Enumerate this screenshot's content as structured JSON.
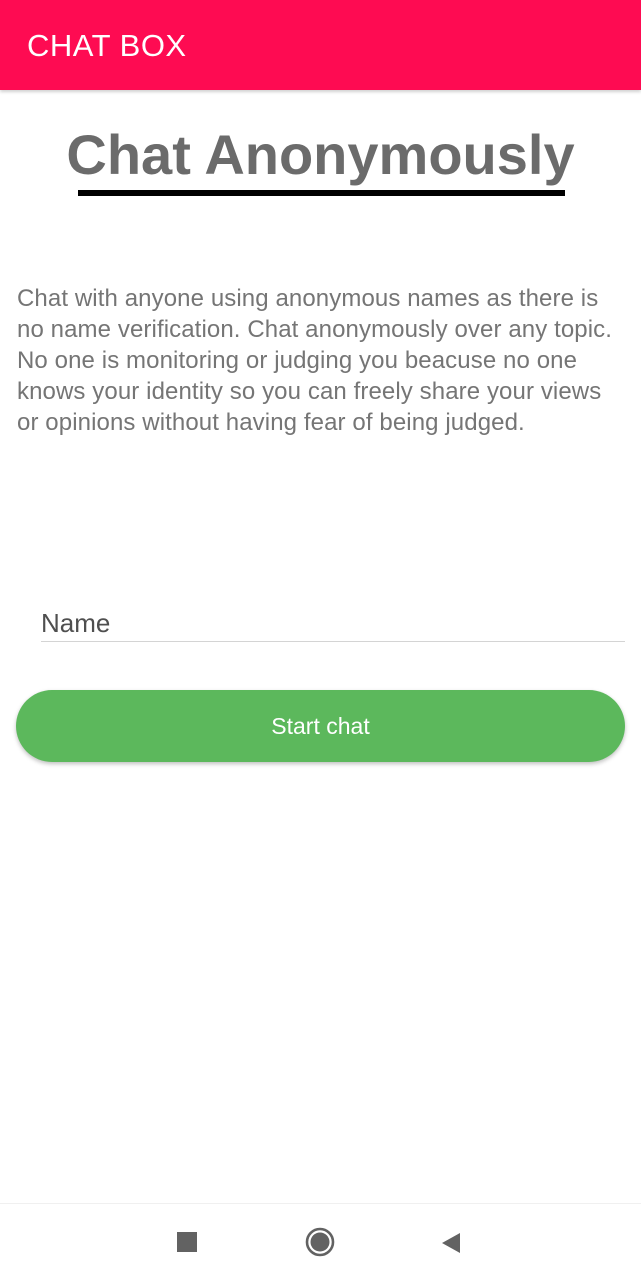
{
  "appbar": {
    "title": "CHAT BOX",
    "color": "#fe0b52"
  },
  "main": {
    "heading": "Chat Anonymously",
    "description": "Chat with anyone using anonymous names as there is no name verification. Chat anonymously over any topic. No one is monitoring or judging you beacuse no one knows your identity so you can freely share your views or opinions without having fear of being judged.",
    "name_input": {
      "placeholder": "Name",
      "value": ""
    },
    "start_button": {
      "label": "Start chat",
      "color": "#5cb85c"
    }
  },
  "navbar": {
    "icons": [
      "recents-square-icon",
      "home-circle-icon",
      "back-triangle-icon"
    ]
  }
}
